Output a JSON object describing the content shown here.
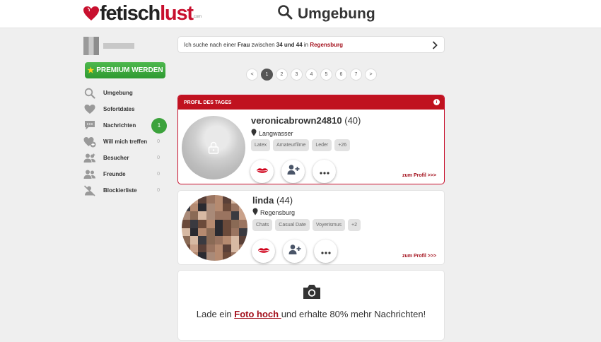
{
  "header": {
    "logo_part1": "fetisch",
    "logo_part2": "lust",
    "logo_sub": "com",
    "page_title": "Umgebung"
  },
  "sidebar": {
    "premium_label": "PREMIUM WERDEN",
    "items": [
      {
        "label": "Umgebung",
        "icon": "search-icon",
        "count": ""
      },
      {
        "label": "Sofortdates",
        "icon": "heart-icon",
        "count": ""
      },
      {
        "label": "Nachrichten",
        "icon": "chat-icon",
        "count": "1"
      },
      {
        "label": "Will mich treffen",
        "icon": "heart-plus-icon",
        "count": "0"
      },
      {
        "label": "Besucher",
        "icon": "visitors-icon",
        "count": "0"
      },
      {
        "label": "Freunde",
        "icon": "friends-icon",
        "count": "0"
      },
      {
        "label": "Blockierliste",
        "icon": "block-user-icon",
        "count": "0"
      }
    ]
  },
  "search": {
    "text_1": "Ich suche nach einer ",
    "gender": "Frau",
    "text_2": " zwischen ",
    "age_range": "34 und 44",
    "text_3": " in ",
    "city": "Regensburg"
  },
  "pagination": {
    "prev": "<",
    "pages": [
      "1",
      "2",
      "3",
      "4",
      "5",
      "6",
      "7"
    ],
    "active": "1",
    "next": ">"
  },
  "featured": {
    "header": "PROFIL DES TAGES",
    "info": "i",
    "name": "veronicabrown24810",
    "age": "(40)",
    "location": "Langwasser",
    "tags": [
      "Latex",
      "Amateurfilme",
      "Leder",
      "+26"
    ],
    "link": "zum Profil >>>"
  },
  "profile": {
    "name": "linda",
    "age": "(44)",
    "location": "Regensburg",
    "tags": [
      "Chats",
      "Casual Date",
      "Voyerismus",
      "+2"
    ],
    "link": "zum Profil >>>"
  },
  "upload": {
    "text_before": "Lade ein ",
    "link": "Foto hoch ",
    "text_after": "und erhalte 80% mehr Nachrichten!"
  },
  "colors": {
    "brand_red": "#c0121f",
    "premium_green": "#2e9a31",
    "link_red": "#a30f1b"
  }
}
